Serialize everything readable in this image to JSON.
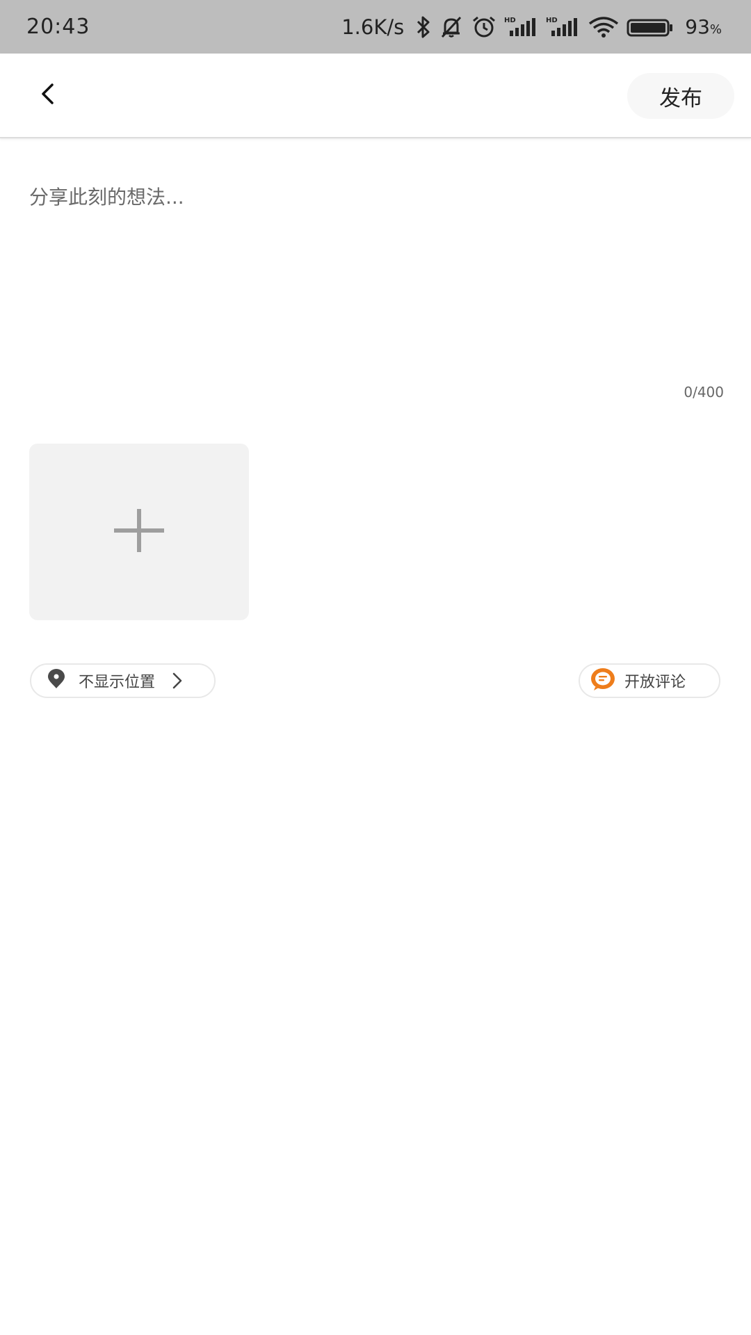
{
  "status_bar": {
    "time": "20:43",
    "network_speed": "1.6K/s",
    "battery_percent": "93",
    "battery_unit": "%",
    "icons": [
      "bluetooth-icon",
      "bell-muted-icon",
      "alarm-icon",
      "hd-signal-icon",
      "hd-signal-icon",
      "wifi-icon",
      "battery-icon"
    ]
  },
  "header": {
    "back_icon": "chevron-left-icon",
    "publish_label": "发布"
  },
  "editor": {
    "placeholder": "分享此刻的想法...",
    "value": "",
    "char_count": "0/400"
  },
  "media": {
    "add_icon": "plus-icon"
  },
  "options": {
    "location_label": "不显示位置",
    "location_icon": "location-pin-icon",
    "comment_label": "开放评论",
    "comment_icon": "comment-bubble-icon",
    "comment_icon_color": "#ee7d1b"
  }
}
